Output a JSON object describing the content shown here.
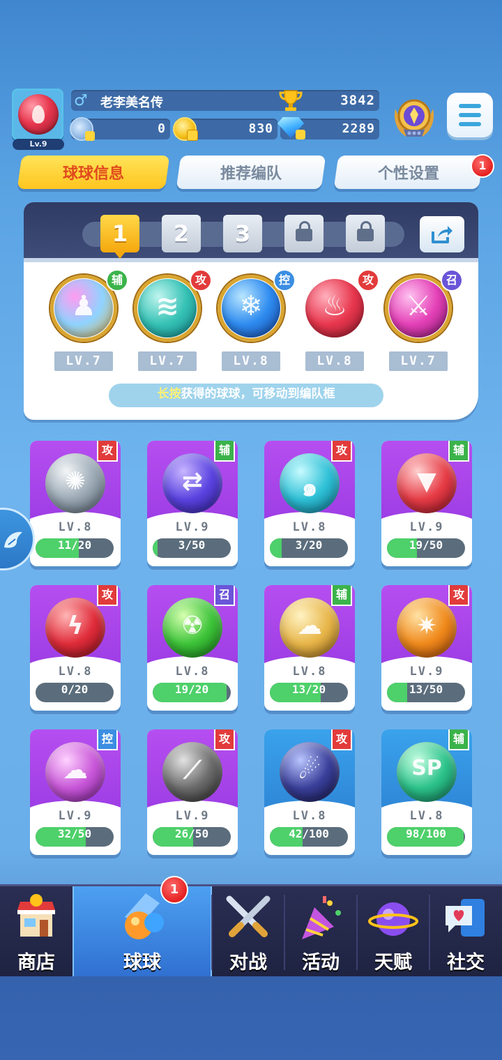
{
  "player": {
    "level": "Lv.9",
    "gender_symbol": "♂",
    "name": "老李美名传",
    "trophies": "3842",
    "energy": "0",
    "gold": "830",
    "gems": "2289"
  },
  "tabs": [
    {
      "label": "球球信息",
      "active": true
    },
    {
      "label": "推荐编队",
      "active": false
    },
    {
      "label": "个性设置",
      "active": false,
      "badge": "1"
    }
  ],
  "team_panel": {
    "slots": [
      {
        "label": "1",
        "state": "active"
      },
      {
        "label": "2",
        "state": "normal"
      },
      {
        "label": "3",
        "state": "normal"
      },
      {
        "label": "",
        "state": "locked"
      },
      {
        "label": "",
        "state": "locked"
      }
    ],
    "balls": [
      {
        "role": "辅",
        "level": "LV.7",
        "icon": "crowd-ball-icon",
        "colors": [
          "#ff9cf0",
          "#8fd3ff",
          "#e3b34a"
        ]
      },
      {
        "role": "攻",
        "level": "LV.7",
        "icon": "tornado-ball-icon",
        "colors": [
          "#bff5ef",
          "#36c2b5",
          "#0f7e86"
        ]
      },
      {
        "role": "控",
        "level": "LV.8",
        "icon": "snowflake-ball-icon",
        "colors": [
          "#b8e6ff",
          "#2f8cf0",
          "#123f9c"
        ]
      },
      {
        "role": "攻",
        "level": "LV.8",
        "icon": "fire-ball-icon",
        "colors": [
          "#ffb0bd",
          "#e8374e",
          "#8c1628"
        ]
      },
      {
        "role": "召",
        "level": "LV.7",
        "icon": "knife-ball-icon",
        "colors": [
          "#ffc2f0",
          "#e441b7",
          "#7d1467"
        ]
      }
    ],
    "hint_highlight": "长按",
    "hint_rest": "获得的球球，可移动到编队框"
  },
  "cards": [
    {
      "role": "攻",
      "level": "LV.8",
      "progress": "11/20",
      "ratio": 0.55,
      "icon": "wind-ball-icon",
      "bg": "purple",
      "colors": [
        "#f3f6f8",
        "#9aa8b4",
        "#4b5866"
      ]
    },
    {
      "role": "辅",
      "level": "LV.9",
      "progress": "3/50",
      "ratio": 0.06,
      "icon": "swap-arrows-ball-icon",
      "bg": "purple",
      "colors": [
        "#c9b6ff",
        "#5a43e0",
        "#2a1c8c"
      ]
    },
    {
      "role": "攻",
      "level": "LV.8",
      "progress": "3/20",
      "ratio": 0.15,
      "icon": "vortex-ball-icon",
      "bg": "purple",
      "colors": [
        "#c8fbff",
        "#2ec0d6",
        "#0b6d86"
      ]
    },
    {
      "role": "辅",
      "level": "LV.9",
      "progress": "19/50",
      "ratio": 0.38,
      "icon": "fangs-ball-icon",
      "bg": "purple",
      "colors": [
        "#ffd0d0",
        "#e63c46",
        "#8a1020"
      ]
    },
    {
      "role": "攻",
      "level": "LV.8",
      "progress": "0/20",
      "ratio": 0.0,
      "icon": "lightning-ball-icon",
      "bg": "purple",
      "colors": [
        "#ffb6b6",
        "#e02c3a",
        "#7c0d16"
      ]
    },
    {
      "role": "召",
      "level": "LV.8",
      "progress": "19/20",
      "ratio": 0.95,
      "icon": "radiation-ball-icon",
      "bg": "purple",
      "colors": [
        "#d6ffb0",
        "#3ec43a",
        "#137012"
      ]
    },
    {
      "role": "辅",
      "level": "LV.8",
      "progress": "13/20",
      "ratio": 0.65,
      "icon": "bubble-ball-icon",
      "bg": "purple",
      "colors": [
        "#fff3c4",
        "#e8b64a",
        "#8d5f12"
      ]
    },
    {
      "role": "攻",
      "level": "LV.9",
      "progress": "13/50",
      "ratio": 0.26,
      "icon": "staff-ball-icon",
      "bg": "purple",
      "colors": [
        "#ffe2a6",
        "#f08a1c",
        "#9a3f06"
      ]
    },
    {
      "role": "控",
      "level": "LV.9",
      "progress": "32/50",
      "ratio": 0.64,
      "icon": "cloud-ball-icon",
      "bg": "purple",
      "colors": [
        "#ffd2ff",
        "#c857d8",
        "#6e1b85"
      ]
    },
    {
      "role": "攻",
      "level": "LV.9",
      "progress": "26/50",
      "ratio": 0.52,
      "icon": "scythe-ball-icon",
      "bg": "purple",
      "colors": [
        "#e3e3e3",
        "#6b6b6b",
        "#222222"
      ]
    },
    {
      "role": "攻",
      "level": "LV.8",
      "progress": "42/100",
      "ratio": 0.42,
      "icon": "meteor-ball-icon",
      "bg": "blue",
      "colors": [
        "#b9c6ff",
        "#3a3f9a",
        "#10123e"
      ]
    },
    {
      "role": "辅",
      "level": "LV.8",
      "progress": "98/100",
      "ratio": 0.98,
      "icon": "sp-hands-ball-icon",
      "bg": "blue",
      "colors": [
        "#c8ffe3",
        "#2cc28a",
        "#0d6d4f"
      ]
    }
  ],
  "nav": [
    {
      "label": "商店",
      "icon": "shop-icon"
    },
    {
      "label": "球球",
      "icon": "balls-icon",
      "active": true,
      "badge": "1"
    },
    {
      "label": "对战",
      "icon": "crossed-swords-icon"
    },
    {
      "label": "活动",
      "icon": "party-popper-icon"
    },
    {
      "label": "天赋",
      "icon": "planet-icon"
    },
    {
      "label": "社交",
      "icon": "chat-heart-icon"
    }
  ]
}
